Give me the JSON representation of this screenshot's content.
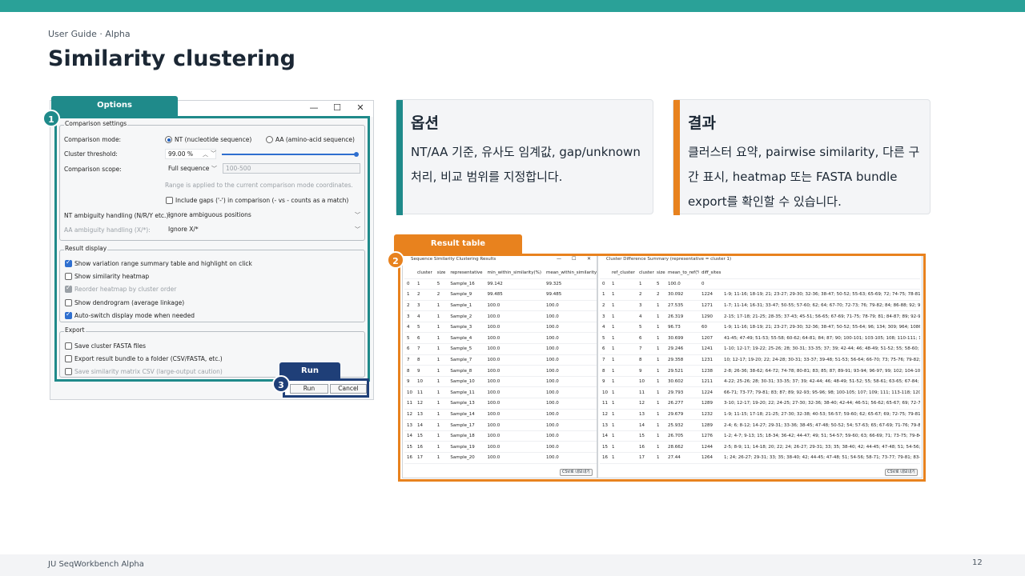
{
  "header": {
    "subtitle": "User Guide · Alpha",
    "title": "Similarity clustering"
  },
  "footer": {
    "left": "JU SeqWorkbench Alpha",
    "page": "12"
  },
  "colors": {
    "teal": "#1f8a8a",
    "orange": "#e8821e",
    "navy": "#1f3f78",
    "topbar": "#2aa198"
  },
  "options_dialog": {
    "tab_label": "Options",
    "badges": [
      "1",
      "3"
    ],
    "window_controls": [
      "—",
      "☐",
      "✕"
    ],
    "comparison": {
      "group_title": "Comparison settings",
      "mode_label": "Comparison mode:",
      "mode_nt": "NT (nucleotide sequence)",
      "mode_aa": "AA (amino-acid sequence)",
      "threshold_label": "Cluster threshold:",
      "threshold_value": "99.00 %",
      "threshold_fraction": 0.99,
      "scope_label": "Comparison scope:",
      "scope_value": "Full sequence",
      "range_placeholder": "100-500",
      "range_note": "Range is applied to the current comparison mode coordinates.",
      "include_gaps": "Include gaps ('-') in comparison (- vs - counts as a match)",
      "nt_ambiguity_label": "NT ambiguity handling (N/R/Y etc.):",
      "nt_ambiguity_value": "Ignore ambiguous positions",
      "aa_ambiguity_label": "AA ambiguity handling (X/*):",
      "aa_ambiguity_value": "Ignore X/*"
    },
    "result_display": {
      "group_title": "Result display",
      "opt1": "Show variation range summary table and highlight on click",
      "opt2": "Show similarity heatmap",
      "opt3": "Reorder heatmap by cluster order",
      "opt4": "Show dendrogram (average linkage)",
      "opt5": "Auto-switch display mode when needed"
    },
    "export": {
      "group_title": "Export",
      "opt1": "Save cluster FASTA files",
      "opt2": "Export result bundle to a folder (CSV/FASTA, etc.)",
      "opt3": "Save similarity matrix CSV (large-output caution)"
    },
    "run_tab": "Run",
    "run_button": "Run",
    "cancel_button": "Cancel"
  },
  "cards": {
    "options": {
      "title": "옵션",
      "body": "NT/AA 기준, 유사도 임계값, gap/unknown 처리, 비교 범위를 지정합니다."
    },
    "results": {
      "title": "결과",
      "body": "클러스터 요약, pairwise similarity, 다른 구간 표시, heatmap 또는 FASTA bundle export를 확인할 수 있습니다."
    }
  },
  "result_table": {
    "tab_label": "Result table",
    "badge": "2",
    "left_window": {
      "title": "Sequence Similarity Clustering Results",
      "columns": [
        "",
        "cluster",
        "size",
        "representative",
        "min_within_similarity(%)",
        "mean_within_similarity(%)",
        "s"
      ],
      "rows": [
        [
          "0",
          "1",
          "5",
          "Sample_16",
          "99.142",
          "99.325",
          "9"
        ],
        [
          "1",
          "2",
          "2",
          "Sample_9",
          "99.485",
          "99.485",
          "9"
        ],
        [
          "2",
          "3",
          "1",
          "Sample_1",
          "100.0",
          "100.0",
          "1"
        ],
        [
          "3",
          "4",
          "1",
          "Sample_2",
          "100.0",
          "100.0",
          "1"
        ],
        [
          "4",
          "5",
          "1",
          "Sample_3",
          "100.0",
          "100.0",
          "1"
        ],
        [
          "5",
          "6",
          "1",
          "Sample_4",
          "100.0",
          "100.0",
          "1"
        ],
        [
          "6",
          "7",
          "1",
          "Sample_5",
          "100.0",
          "100.0",
          "1"
        ],
        [
          "7",
          "8",
          "1",
          "Sample_7",
          "100.0",
          "100.0",
          "1"
        ],
        [
          "8",
          "9",
          "1",
          "Sample_8",
          "100.0",
          "100.0",
          "1"
        ],
        [
          "9",
          "10",
          "1",
          "Sample_10",
          "100.0",
          "100.0",
          "1"
        ],
        [
          "10",
          "11",
          "1",
          "Sample_11",
          "100.0",
          "100.0",
          "1"
        ],
        [
          "11",
          "12",
          "1",
          "Sample_13",
          "100.0",
          "100.0",
          "1"
        ],
        [
          "12",
          "13",
          "1",
          "Sample_14",
          "100.0",
          "100.0",
          "1"
        ],
        [
          "13",
          "14",
          "1",
          "Sample_17",
          "100.0",
          "100.0",
          "1"
        ],
        [
          "14",
          "15",
          "1",
          "Sample_18",
          "100.0",
          "100.0",
          "1"
        ],
        [
          "15",
          "16",
          "1",
          "Sample_19",
          "100.0",
          "100.0",
          "1"
        ],
        [
          "16",
          "17",
          "1",
          "Sample_20",
          "100.0",
          "100.0",
          "1"
        ]
      ],
      "csv_button": "CSV로 내보내기"
    },
    "right_window": {
      "title": "Cluster Difference Summary (representative = cluster 1)",
      "columns": [
        "",
        "ref_cluster",
        "cluster",
        "size",
        "mean_to_ref(%)",
        "diff_sites",
        ""
      ],
      "rows": [
        [
          "0",
          "1",
          "1",
          "5",
          "100.0",
          "0",
          ""
        ],
        [
          "1",
          "1",
          "2",
          "2",
          "30.092",
          "1224",
          "1-9; 11-16; 18-19; 21; 23-27; 29-30; 32-36; 38-47; 50-52; 55-63; 65-69; 72; 74-75; 78-81; 83-8"
        ],
        [
          "2",
          "1",
          "3",
          "1",
          "27.535",
          "1271",
          "1-7; 11-14; 16-31; 33-47; 50-55; 57-60; 62; 64; 67-70; 72-73; 76; 79-82; 84; 86-88; 92; 94-96; 9"
        ],
        [
          "3",
          "1",
          "4",
          "1",
          "26.319",
          "1290",
          "2-15; 17-18; 21-25; 28-35; 37-43; 45-51; 56-65; 67-69; 71-75; 78-79; 81; 84-87; 89; 92-93; 96; 9"
        ],
        [
          "4",
          "1",
          "5",
          "1",
          "96.73",
          "60",
          "1-9; 11-16; 18-19; 21; 23-27; 29-30; 32-36; 38-47; 50-52; 55-64; 96; 134; 309; 964; 1086; 1250;"
        ],
        [
          "5",
          "1",
          "6",
          "1",
          "30.699",
          "1207",
          "41-45; 47-49; 51-53; 55-58; 60-62; 64-81; 84; 87; 90; 100-101; 103-105; 108; 110-111; 113; 11"
        ],
        [
          "6",
          "1",
          "7",
          "1",
          "29.246",
          "1241",
          "1-10; 12-17; 19-22; 25-26; 28; 30-31; 33-35; 37; 39; 42-44; 46; 48-49; 51-52; 55; 58-60; 62-75;"
        ],
        [
          "7",
          "1",
          "8",
          "1",
          "29.358",
          "1231",
          "10; 12-17; 19-20; 22; 24-28; 30-31; 33-37; 39-48; 51-53; 56-64; 66-70; 73; 75-76; 79-82; 84-85"
        ],
        [
          "8",
          "1",
          "9",
          "1",
          "29.521",
          "1238",
          "2-8; 26-36; 38-62; 64-72; 74-78; 80-81; 83; 85; 87; 89-91; 93-94; 96-97; 99; 102; 104-106; 109;"
        ],
        [
          "9",
          "1",
          "10",
          "1",
          "30.602",
          "1211",
          "4-22; 25-26; 28; 30-31; 33-35; 37; 39; 42-44; 46; 48-49; 51-52; 55; 58-61; 63-65; 67-84; 87; 90;"
        ],
        [
          "10",
          "1",
          "11",
          "1",
          "29.793",
          "1224",
          "66-71; 73-77; 79-81; 83; 87; 89; 92-93; 95-96; 98; 100-105; 107; 109; 111; 113-118; 120-126; 1"
        ],
        [
          "11",
          "1",
          "12",
          "1",
          "26.277",
          "1289",
          "3-10; 12-17; 19-20; 22; 24-25; 27-30; 32-36; 38-40; 42-44; 46-51; 56-62; 65-67; 69; 72-75; 78-8"
        ],
        [
          "12",
          "1",
          "13",
          "1",
          "29.679",
          "1232",
          "1-9; 11-15; 17-18; 21-25; 27-30; 32-38; 40-53; 56-57; 59-60; 62; 65-67; 69; 72-75; 79-81; 84-87"
        ],
        [
          "13",
          "1",
          "14",
          "1",
          "25.932",
          "1289",
          "2-4; 6; 8-12; 14-27; 29-31; 33-36; 38-45; 47-48; 50-52; 54; 57-63; 65; 67-69; 71-76; 79-81; 84-8"
        ],
        [
          "14",
          "1",
          "15",
          "1",
          "26.705",
          "1276",
          "1-2; 4-7; 9-13; 15; 18-34; 36-42; 44-47; 49; 51; 54-57; 59-60; 63; 66-69; 71; 73-75; 79-84; 86-8"
        ],
        [
          "15",
          "1",
          "16",
          "1",
          "28.662",
          "1244",
          "2-5; 8-9; 11; 14-18; 20; 22; 24; 26-27; 29-31; 33; 35; 38-40; 42; 44-45; 47-48; 51; 54-56; 58-60;"
        ],
        [
          "16",
          "1",
          "17",
          "1",
          "27.44",
          "1264",
          "1; 24; 26-27; 29-31; 33; 35; 38-40; 42; 44-45; 47-48; 51; 54-56; 58-71; 73-77; 79-81; 83-84; 87;"
        ]
      ],
      "csv_button": "CSV로 내보내기"
    }
  }
}
